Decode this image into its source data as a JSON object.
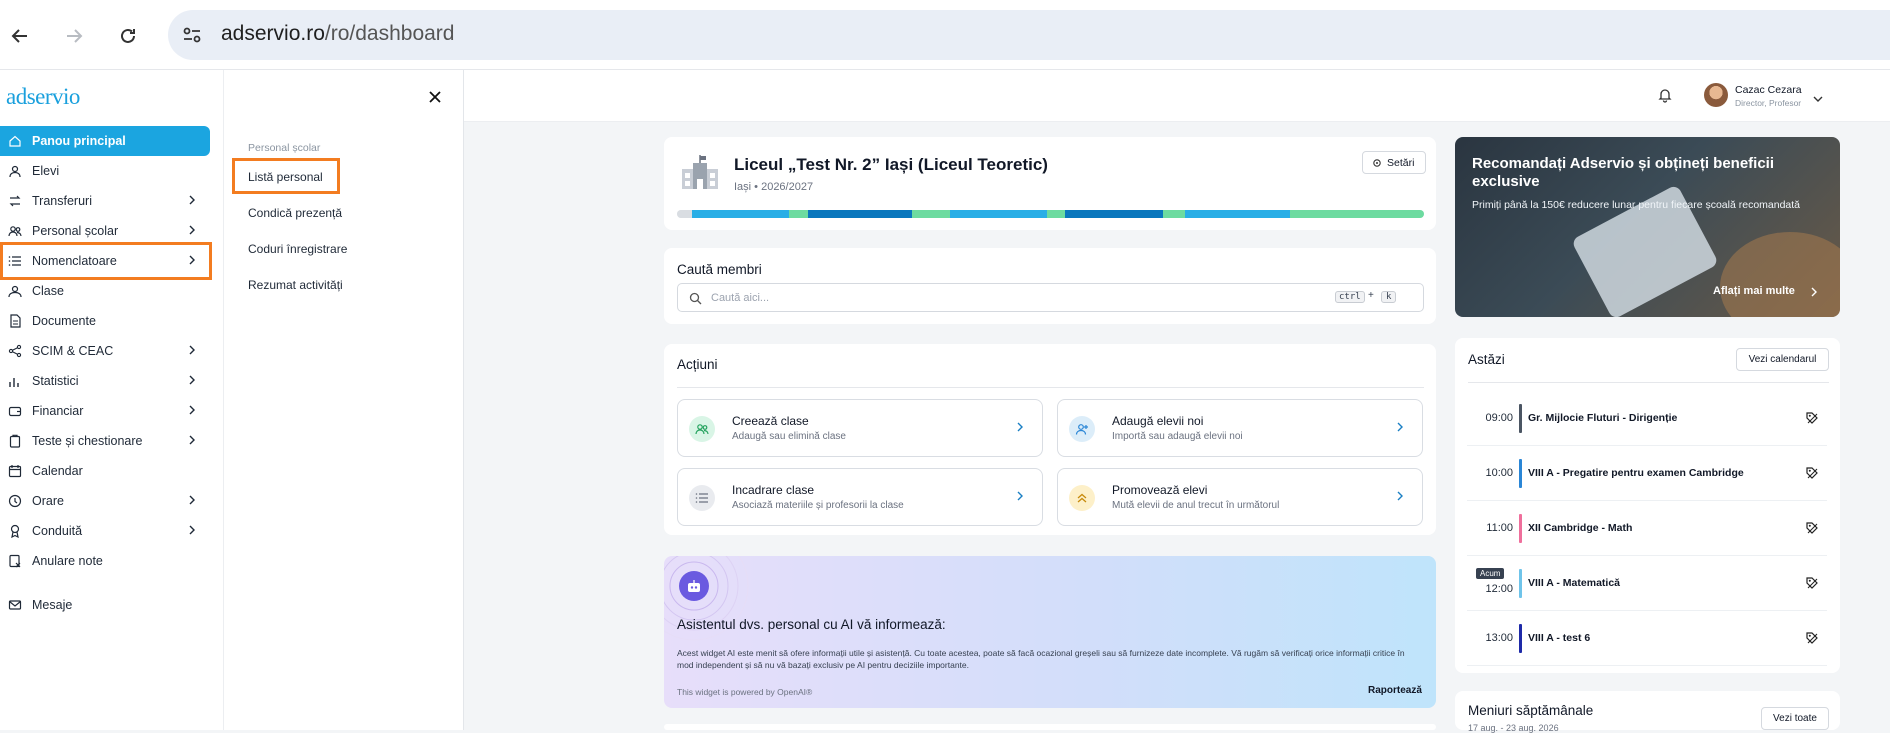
{
  "browser": {
    "url_host": "adservio.ro",
    "url_path": "/ro/dashboard"
  },
  "sidebar": {
    "logo": "adservio",
    "items": [
      {
        "label": "Panou principal",
        "icon": "home-icon",
        "chevron": false
      },
      {
        "label": "Elevi",
        "icon": "user-icon",
        "chevron": false
      },
      {
        "label": "Transferuri",
        "icon": "transfer-icon",
        "chevron": true
      },
      {
        "label": "Personal școlar",
        "icon": "users-icon",
        "chevron": true
      },
      {
        "label": "Nomenclatoare",
        "icon": "list-icon",
        "chevron": true
      },
      {
        "label": "Clase",
        "icon": "group-icon",
        "chevron": false
      },
      {
        "label": "Documente",
        "icon": "document-icon",
        "chevron": false
      },
      {
        "label": "SCIM & CEAC",
        "icon": "network-icon",
        "chevron": true
      },
      {
        "label": "Statistici",
        "icon": "bar-chart-icon",
        "chevron": true
      },
      {
        "label": "Financiar",
        "icon": "wallet-icon",
        "chevron": true
      },
      {
        "label": "Teste și chestionare",
        "icon": "clipboard-icon",
        "chevron": true
      },
      {
        "label": "Calendar",
        "icon": "calendar-icon",
        "chevron": false
      },
      {
        "label": "Orare",
        "icon": "clock-icon",
        "chevron": true
      },
      {
        "label": "Conduită",
        "icon": "award-icon",
        "chevron": true
      },
      {
        "label": "Anulare note",
        "icon": "cancel-doc-icon",
        "chevron": false
      },
      {
        "label": "Mesaje",
        "icon": "mail-icon",
        "chevron": false
      }
    ]
  },
  "submenu": {
    "heading": "Personal școlar",
    "items": [
      "Listă personal",
      "Condică prezență",
      "Coduri înregistrare",
      "Rezumat activități"
    ]
  },
  "header": {
    "user_name": "Cazac Cezara",
    "user_role": "Director, Profesor"
  },
  "school": {
    "name": "Liceul „Test Nr. 2” Iași (Liceul Teoretic)",
    "subtitle": "Iași • 2026/2027",
    "settings_label": "Setări",
    "progress_colors": [
      "#29aee6",
      "#6ddba0",
      "#0a77bd",
      "#6ddba0",
      "#29aee6",
      "#6ddba0",
      "#0a77bd",
      "#6ddba0",
      "#29aee6",
      "#6ddba0"
    ]
  },
  "search": {
    "title": "Caută membri",
    "placeholder": "Caută aici...",
    "shortcut_ctrl": "ctrl",
    "shortcut_plus": "+",
    "shortcut_key": "k"
  },
  "actions": {
    "title": "Acțiuni",
    "items": [
      {
        "title": "Creează clase",
        "desc": "Adaugă sau elimină clase",
        "icon": "users-icon",
        "color": "#d9f5e6"
      },
      {
        "title": "Adaugă elevii noi",
        "desc": "Importă sau adaugă elevii noi",
        "icon": "user-plus-icon",
        "color": "#dcedf9"
      },
      {
        "title": "Incadrare clase",
        "desc": "Asociază materiile și profesorii la clase",
        "icon": "list-icon",
        "color": "#e9ebef"
      },
      {
        "title": "Promovează elevi",
        "desc": "Mută elevii de anul trecut în următorul",
        "icon": "double-chevron-up-icon",
        "color": "#fdf0c9"
      }
    ]
  },
  "ai": {
    "title": "Asistentul dvs. personal cu AI vă informează:",
    "body": "Acest widget AI este menit să ofere informații utile și asistență. Cu toate acestea, poate să facă ocazional greșeli sau să furnizeze date incomplete. Vă rugăm să verificați orice informații critice în mod independent și să nu vă bazați exclusiv pe AI pentru deciziile importante.",
    "powered": "This widget is powered by OpenAI®",
    "report": "Raportează"
  },
  "promo": {
    "title": "Recomandați Adservio și obțineți beneficii exclusive",
    "text": "Primiți până la 150€ reducere lunar pentru fiecare școală recomandată",
    "link": "Aflați mai multe"
  },
  "today": {
    "title": "Astăzi",
    "calendar_btn": "Vezi calendarul",
    "now_label": "Acum",
    "items": [
      {
        "time": "09:00",
        "name": "Gr. Mijlocie Fluturi - Dirigenție",
        "color": "#4b5563"
      },
      {
        "time": "10:00",
        "name": "VIII A - Pregatire pentru examen Cambridge",
        "color": "#2a86d6"
      },
      {
        "time": "11:00",
        "name": "XII Cambridge - Math",
        "color": "#ef6f9c"
      },
      {
        "time": "12:00",
        "name": "VIII A - Matematică",
        "color": "#6fc4ea"
      },
      {
        "time": "13:00",
        "name": "VIII A - test 6",
        "color": "#1e2aa8"
      }
    ]
  },
  "menus": {
    "title": "Meniuri săptămânale",
    "range": "17 aug. - 23 aug. 2026",
    "btn": "Vezi toate"
  }
}
